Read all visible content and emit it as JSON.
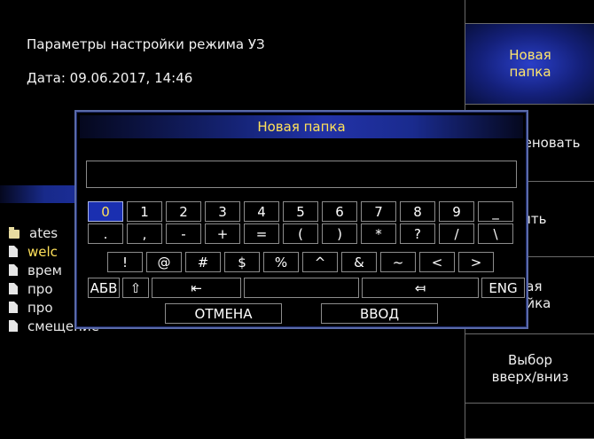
{
  "header": {
    "mode_title": "Параметры настройки режима УЗ",
    "date_line": "Дата: 09.06.2017, 14:46"
  },
  "files": [
    {
      "name": "ates",
      "type": "folder",
      "selected": false
    },
    {
      "name": "welc",
      "type": "file",
      "selected": true
    },
    {
      "name": "врем",
      "type": "file",
      "selected": false
    },
    {
      "name": "про",
      "type": "file",
      "selected": false
    },
    {
      "name": "про",
      "type": "file",
      "selected": false
    },
    {
      "name": "смещение",
      "type": "file",
      "selected": false
    }
  ],
  "side_menu": [
    {
      "label": "",
      "active": false
    },
    {
      "label": "Новая\nпапка",
      "active": true
    },
    {
      "label": "ереименовать",
      "active": false
    },
    {
      "label": "лить",
      "active": false
    },
    {
      "label": "вая\nройка",
      "active": false
    },
    {
      "label": "Выбор\nвверх/вниз",
      "active": false
    },
    {
      "label": "",
      "active": false
    }
  ],
  "dialog": {
    "title": "Новая папка",
    "input_value": "",
    "keys": {
      "row1": [
        "0",
        "1",
        "2",
        "3",
        "4",
        "5",
        "6",
        "7",
        "8",
        "9",
        "_"
      ],
      "row2": [
        ".",
        ",",
        "-",
        "+",
        "=",
        "(",
        ")",
        "*",
        "?",
        "/",
        "\\"
      ],
      "row3": [
        "!",
        "@",
        "#",
        "$",
        "%",
        "^",
        "&",
        "~",
        "<",
        ">"
      ],
      "row4": [
        "АБВ",
        "⇧",
        "⇤",
        "",
        "⤆",
        "ENG"
      ],
      "row5": [
        "ОТМЕНА",
        "ВВОД"
      ]
    }
  },
  "colors": {
    "accent": "#ffe15a",
    "key_border": "#8c8c8c",
    "active_key": "#1a2fb0"
  }
}
